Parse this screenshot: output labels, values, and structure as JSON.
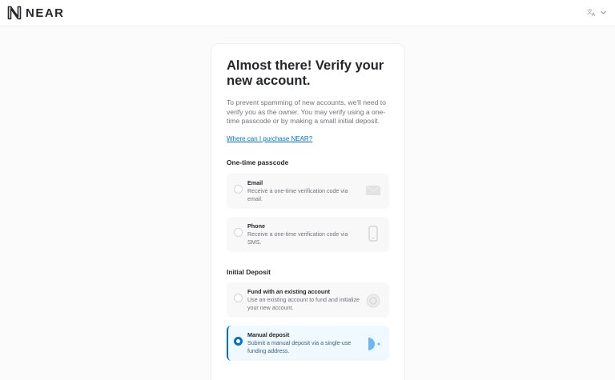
{
  "header": {
    "brand": "NEAR",
    "language_icon": "translate-icon"
  },
  "main": {
    "title": "Almost there! Verify your new account.",
    "description": "To prevent spamming of new accounts, we'll need to verify you as the owner. You may verify using a one-time passcode or by making a small initial deposit.",
    "purchase_link": "Where can I purchase NEAR?",
    "otp_section": {
      "heading": "One-time passcode",
      "options": [
        {
          "title": "Email",
          "description": "Receive a one-time verification code via email.",
          "icon": "envelope-icon",
          "selected": false
        },
        {
          "title": "Phone",
          "description": "Receive a one-time verification code via SMS.",
          "icon": "phone-icon",
          "selected": false
        }
      ]
    },
    "deposit_section": {
      "heading": "Initial Deposit",
      "options": [
        {
          "title": "Fund with an existing account",
          "description": "Use an existing account to fund and initialize your new account.",
          "icon": "account-icon",
          "selected": false
        },
        {
          "title": "Manual deposit",
          "description": "Submit a manual deposit via a single-use funding address.",
          "icon": "deposit-icon",
          "selected": true
        }
      ]
    }
  },
  "colors": {
    "accent": "#0072ce",
    "selected_bg": "#f0f9ff",
    "option_bg": "#f8f8f8"
  }
}
